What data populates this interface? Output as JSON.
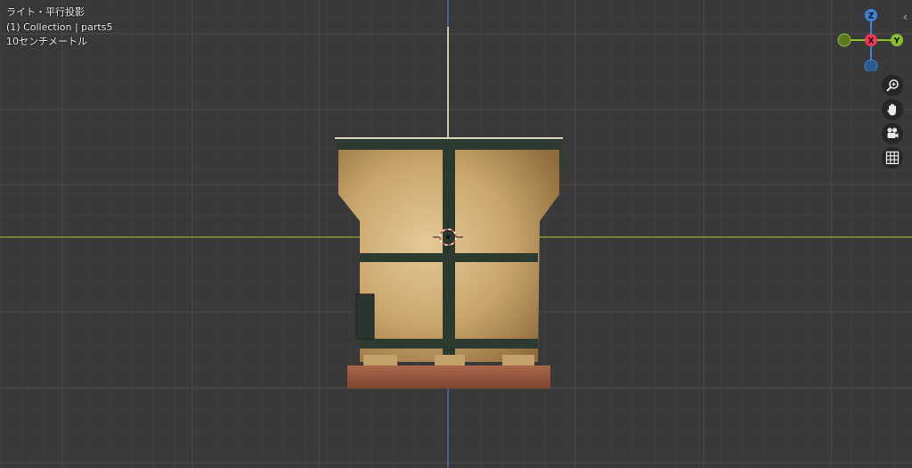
{
  "viewport": {
    "view_name": "ライト・平行投影",
    "collection_info": "(1) Collection | parts5",
    "unit_scale": "10センチメートル"
  },
  "gizmo": {
    "axis_z": "Z",
    "axis_x": "X",
    "axis_y": "Y"
  },
  "nav_buttons": [
    {
      "name": "zoom",
      "icon": "zoom-icon"
    },
    {
      "name": "pan",
      "icon": "hand-icon"
    },
    {
      "name": "camera",
      "icon": "camera-icon"
    },
    {
      "name": "grid",
      "icon": "grid-icon"
    }
  ],
  "sidebar_toggle": "‹",
  "colors": {
    "background": "#393939",
    "grid_line": "#444444",
    "axis_x": "#7d9a2c",
    "axis_z": "#4a6ea8",
    "gizmo_x": "#f0375a",
    "gizmo_y": "#8bbf2f",
    "gizmo_z": "#3e82d6",
    "pot_cream": "#d7b98a",
    "pot_frame": "#2c3a30",
    "base_brick": "#9a5a3e"
  }
}
